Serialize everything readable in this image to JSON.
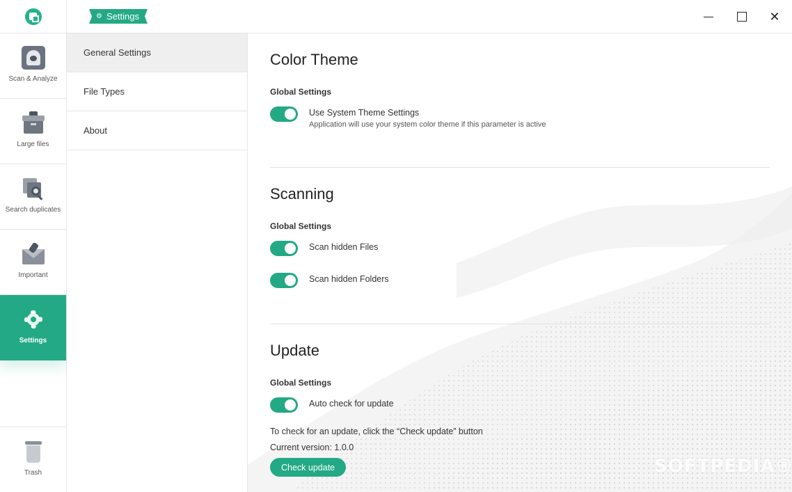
{
  "sidebar": {
    "items": [
      {
        "label": "Scan & Analyze",
        "icon": "scan-icon"
      },
      {
        "label": "Large files",
        "icon": "box-icon"
      },
      {
        "label": "Search duplicates",
        "icon": "duplicates-icon"
      },
      {
        "label": "Important",
        "icon": "envelope-icon"
      },
      {
        "label": "Settings",
        "icon": "gear-icon",
        "active": true
      }
    ],
    "trash": {
      "label": "Trash",
      "icon": "trash-icon"
    }
  },
  "titlebar": {
    "breadcrumb": "Settings",
    "minimize": "minimize-icon",
    "maximize": "maximize-icon",
    "close": "✕"
  },
  "subnav": {
    "items": [
      {
        "label": "General Settings",
        "active": true
      },
      {
        "label": "File Types"
      },
      {
        "label": "About"
      }
    ]
  },
  "main": {
    "color_theme": {
      "title": "Color Theme",
      "group": "Global Settings",
      "toggles": [
        {
          "label": "Use System Theme Settings",
          "description": "Application will use your system color theme if this parameter is active",
          "on": true
        }
      ]
    },
    "scanning": {
      "title": "Scanning",
      "group": "Global Settings",
      "toggles": [
        {
          "label": "Scan hidden Files",
          "on": true
        },
        {
          "label": "Scan hidden Folders",
          "on": true
        }
      ]
    },
    "update": {
      "title": "Update",
      "group": "Global Settings",
      "toggles": [
        {
          "label": "Auto check for update",
          "on": true
        }
      ],
      "note": "To check for an update, click the “Check update” button",
      "version": "Current version: 1.0.0",
      "button": "Check update"
    }
  },
  "watermark": "SOFTPEDIA®",
  "colors": {
    "accent": "#23a985",
    "border": "#e6e6e6",
    "active_subnav": "#efefef"
  }
}
